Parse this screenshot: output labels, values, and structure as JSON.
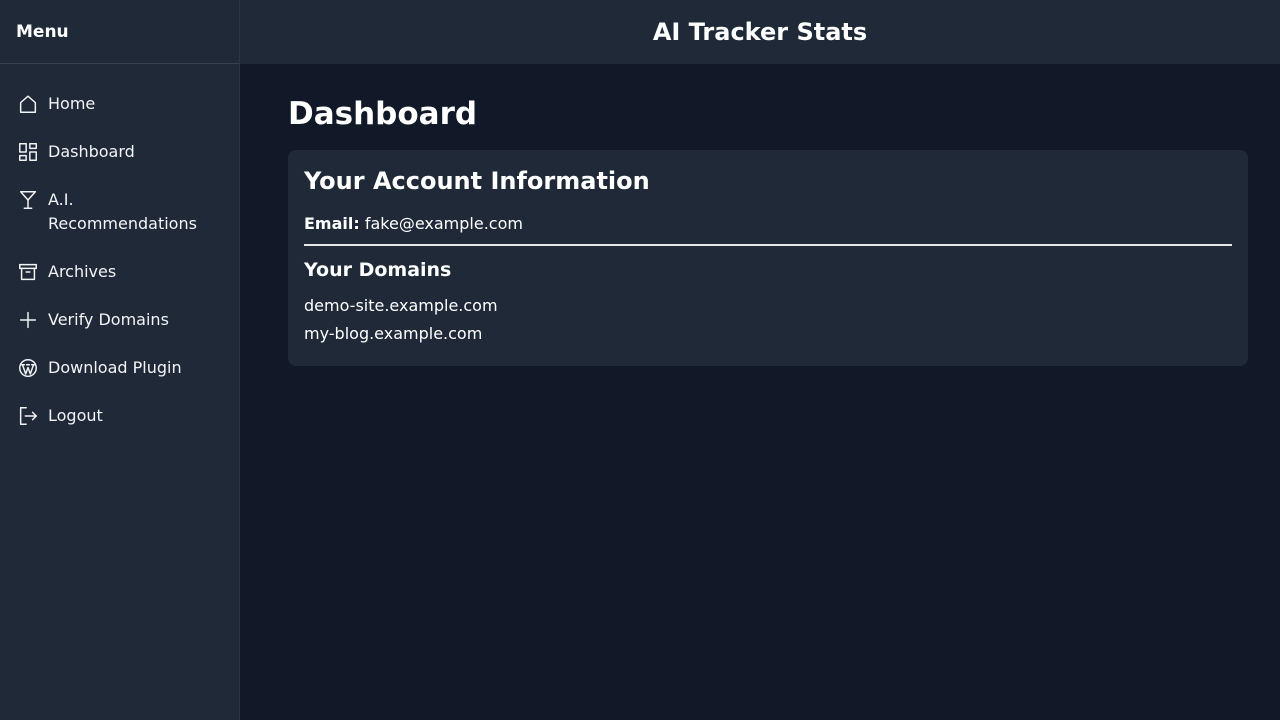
{
  "sidebar": {
    "title": "Menu",
    "items": [
      {
        "label": "Home",
        "icon": "home-icon"
      },
      {
        "label": "Dashboard",
        "icon": "dashboard-icon"
      },
      {
        "label": "A.I. Recommendations",
        "icon": "cocktail-icon"
      },
      {
        "label": "Archives",
        "icon": "archive-icon"
      },
      {
        "label": "Verify Domains",
        "icon": "plus-icon"
      },
      {
        "label": "Download Plugin",
        "icon": "wordpress-icon"
      },
      {
        "label": "Logout",
        "icon": "logout-icon"
      }
    ]
  },
  "header": {
    "app_title": "AI Tracker Stats"
  },
  "main": {
    "page_title": "Dashboard",
    "card": {
      "title": "Your Account Information",
      "email_label": "Email:",
      "email_value": "fake@example.com",
      "domains_title": "Your Domains",
      "domains": [
        "demo-site.example.com",
        "my-blog.example.com"
      ]
    }
  },
  "colors": {
    "background": "#111827",
    "panel": "#1f2937",
    "text": "#ffffff"
  }
}
